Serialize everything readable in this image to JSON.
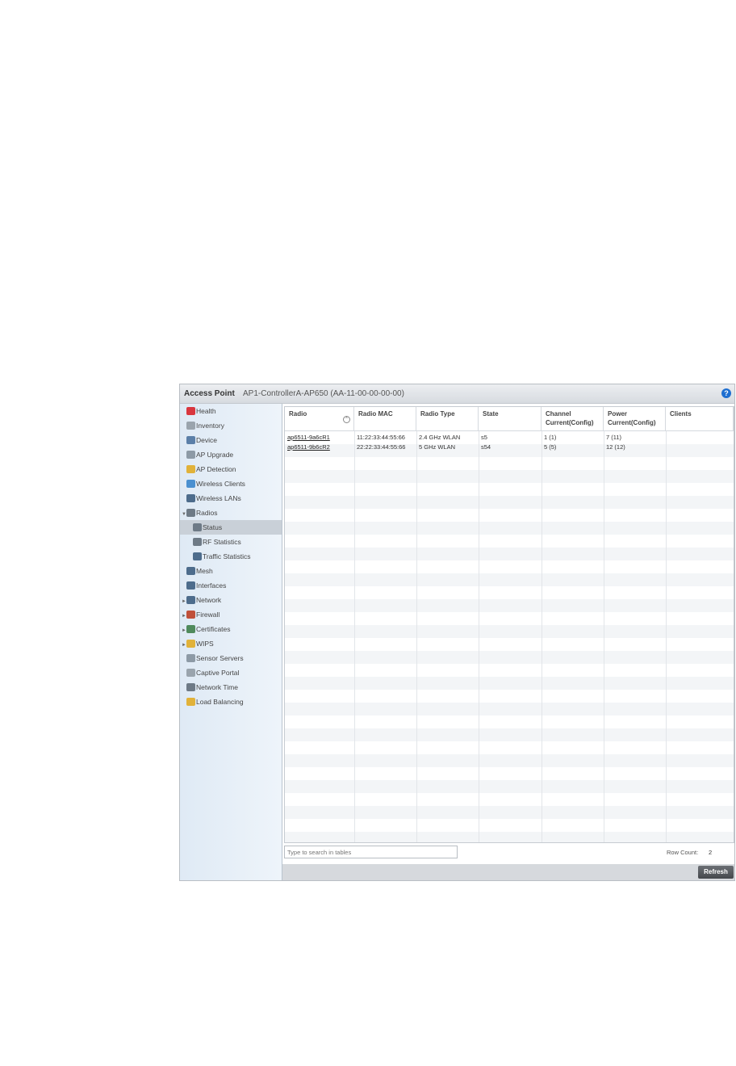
{
  "window": {
    "title": "Access Point",
    "device": "AP1-ControllerA-AP650 (AA-11-00-00-00-00)",
    "help_icon": "?"
  },
  "sidebar": {
    "items": [
      {
        "label": "Health",
        "icon": "health-icon",
        "color": "#d9363e"
      },
      {
        "label": "Inventory",
        "icon": "inventory-icon",
        "color": "#9aa4ad"
      },
      {
        "label": "Device",
        "icon": "device-icon",
        "color": "#5b7fa8"
      },
      {
        "label": "AP Upgrade",
        "icon": "ap-upgrade-icon",
        "color": "#8d9aa6"
      },
      {
        "label": "AP Detection",
        "icon": "ap-detection-icon",
        "color": "#e1b23a"
      },
      {
        "label": "Wireless Clients",
        "icon": "wireless-clients-icon",
        "color": "#4a90d0"
      },
      {
        "label": "Wireless LANs",
        "icon": "wireless-lans-icon",
        "color": "#4d6c8c"
      },
      {
        "label": "Radios",
        "icon": "radios-icon",
        "color": "#6e7a86",
        "arrow": "▼"
      },
      {
        "label": "Status",
        "icon": "status-icon",
        "color": "#6e7a86",
        "selected": true
      },
      {
        "label": "RF Statistics",
        "icon": "rf-statistics-icon",
        "color": "#6e7a86"
      },
      {
        "label": "Traffic Statistics",
        "icon": "traffic-statistics-icon",
        "color": "#4d6c8c"
      },
      {
        "label": "Mesh",
        "icon": "mesh-icon",
        "color": "#4d6c8c"
      },
      {
        "label": "Interfaces",
        "icon": "interfaces-icon",
        "color": "#4d6c8c"
      },
      {
        "label": "Network",
        "icon": "network-icon",
        "color": "#4d6c8c",
        "arrow": "►"
      },
      {
        "label": "Firewall",
        "icon": "firewall-icon",
        "color": "#c0503a",
        "arrow": "►"
      },
      {
        "label": "Certificates",
        "icon": "certificates-icon",
        "color": "#4f8a5c",
        "arrow": "►"
      },
      {
        "label": "WIPS",
        "icon": "wips-icon",
        "color": "#e1b23a",
        "arrow": "►"
      },
      {
        "label": "Sensor Servers",
        "icon": "sensor-servers-icon",
        "color": "#8d9aa6"
      },
      {
        "label": "Captive Portal",
        "icon": "captive-portal-icon",
        "color": "#9aa4ad"
      },
      {
        "label": "Network Time",
        "icon": "network-time-icon",
        "color": "#6e7a86"
      },
      {
        "label": "Load Balancing",
        "icon": "load-balancing-icon",
        "color": "#e1b23a"
      }
    ]
  },
  "table": {
    "columns": [
      {
        "line1": "Radio",
        "line2": ""
      },
      {
        "line1": "Radio MAC",
        "line2": ""
      },
      {
        "line1": "Radio Type",
        "line2": ""
      },
      {
        "line1": "State",
        "line2": ""
      },
      {
        "line1": "Channel",
        "line2": "Current(Config)"
      },
      {
        "line1": "Power",
        "line2": "Current(Config)"
      },
      {
        "line1": "Clients",
        "line2": ""
      }
    ],
    "rows": [
      [
        "ap6511-9a6cR1",
        "11:22:33:44:55:66",
        "2.4 GHz WLAN",
        "s5",
        "1 (1)",
        "7 (11)",
        ""
      ],
      [
        "ap6511-9b6cR2",
        "22:22:33:44:55:66",
        "5 GHz WLAN",
        "s54",
        "5 (5)",
        "12 (12)",
        ""
      ]
    ],
    "sort_icon": "⌃"
  },
  "footer": {
    "search_placeholder": "Type to search in tables",
    "row_count_label": "Row Count:",
    "row_count_value": "2",
    "refresh_label": "Refresh"
  }
}
